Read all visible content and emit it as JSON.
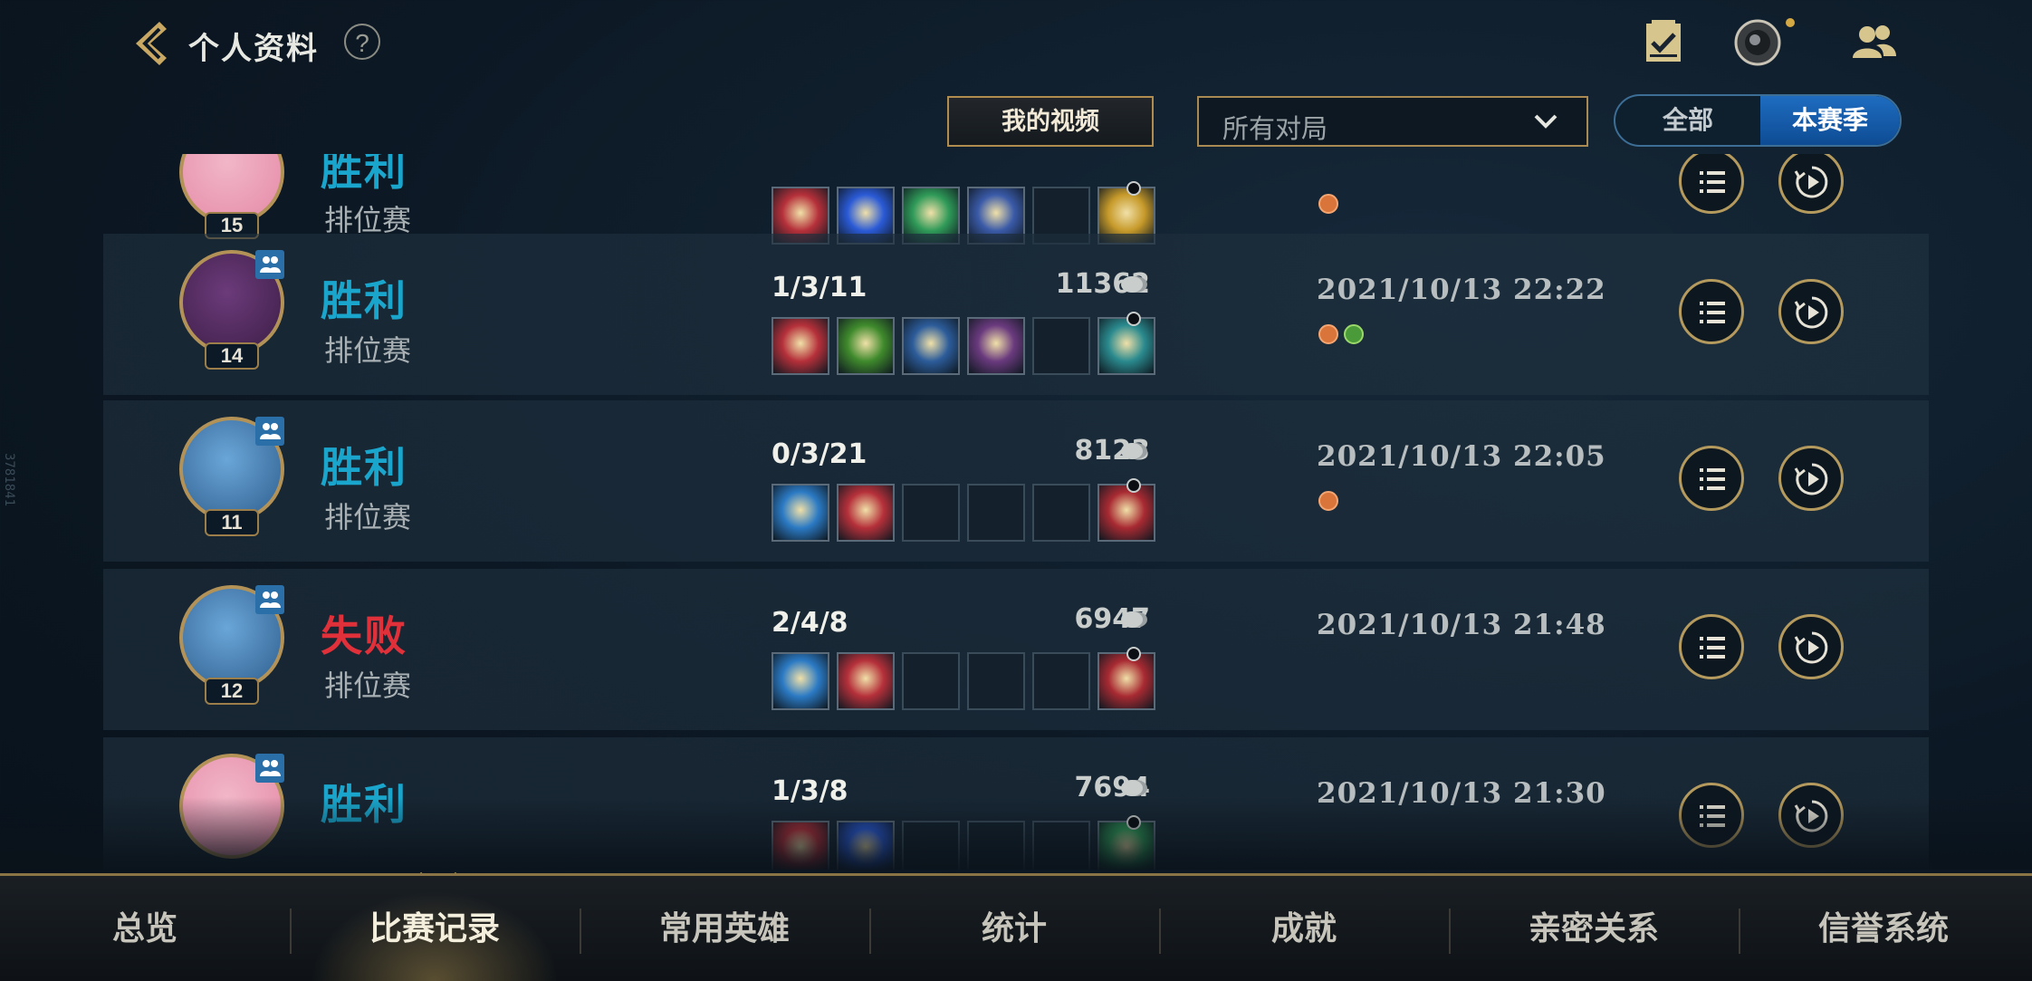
{
  "header": {
    "title": "个人资料",
    "help": "?",
    "video_button": "我的视频",
    "filter": {
      "selected": "所有对局"
    },
    "season_toggle": {
      "all": "全部",
      "season": "本赛季",
      "active": "season"
    }
  },
  "side_id": "3781841",
  "matches": [
    {
      "result": "胜利",
      "result_type": "win",
      "mode": "排位赛",
      "level": "15",
      "kda": "",
      "gold": "",
      "datetime": "",
      "avatar_colors": [
        "#f1b6c8",
        "#e58aa6"
      ],
      "items": [
        "#b5303a",
        "#2a5ad6",
        "#2f9a58",
        "#3a5aa8",
        "",
        "#c79a2a"
      ],
      "spells": [
        "orange"
      ]
    },
    {
      "result": "胜利",
      "result_type": "win",
      "mode": "排位赛",
      "level": "14",
      "kda": "1/3/11",
      "gold": "11362",
      "datetime": "2021/10/13 22:22",
      "avatar_colors": [
        "#6b3a7a",
        "#3c1e46"
      ],
      "items": [
        "#b5303a",
        "#3f8a2c",
        "#2c5c9a",
        "#6a3a7e",
        "",
        "#2a8a8e"
      ],
      "spells": [
        "orange",
        "green"
      ]
    },
    {
      "result": "胜利",
      "result_type": "win",
      "mode": "排位赛",
      "level": "11",
      "kda": "0/3/21",
      "gold": "8123",
      "datetime": "2021/10/13 22:05",
      "avatar_colors": [
        "#6aa6d8",
        "#2e5e8e"
      ],
      "items": [
        "#2b7ac4",
        "#b5303a",
        "",
        "",
        "",
        "#a82a32"
      ],
      "spells": [
        "orange"
      ]
    },
    {
      "result": "失败",
      "result_type": "lose",
      "mode": "排位赛",
      "level": "12",
      "kda": "2/4/8",
      "gold": "6947",
      "datetime": "2021/10/13 21:48",
      "avatar_colors": [
        "#6aa6d8",
        "#2e5e8e"
      ],
      "items": [
        "#2b7ac4",
        "#b5303a",
        "",
        "",
        "",
        "#a82a32"
      ],
      "spells": []
    },
    {
      "result": "胜利",
      "result_type": "win",
      "mode": "",
      "level": "",
      "kda": "1/3/8",
      "gold": "7694",
      "datetime": "2021/10/13 21:30",
      "avatar_colors": [
        "#f1b6c8",
        "#e58aa6"
      ],
      "items": [
        "#b5303a",
        "#2a5ad6",
        "",
        "",
        "",
        "#2f9a58"
      ],
      "spells": []
    }
  ],
  "tabs": [
    "总览",
    "比赛记录",
    "常用英雄",
    "统计",
    "成就",
    "亲密关系",
    "信誉系统"
  ],
  "active_tab": 1
}
